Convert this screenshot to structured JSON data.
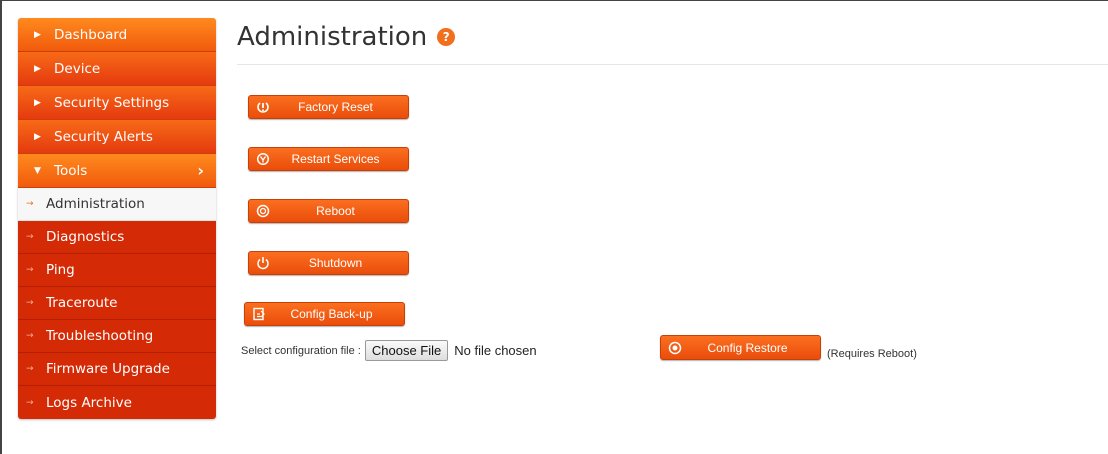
{
  "sidebar": {
    "items": [
      {
        "label": "Dashboard"
      },
      {
        "label": "Device"
      },
      {
        "label": "Security Settings"
      },
      {
        "label": "Security Alerts"
      },
      {
        "label": "Tools"
      }
    ],
    "tools_sub": [
      {
        "label": "Administration",
        "active": true
      },
      {
        "label": "Diagnostics"
      },
      {
        "label": "Ping"
      },
      {
        "label": "Traceroute"
      },
      {
        "label": "Troubleshooting"
      },
      {
        "label": "Firmware Upgrade"
      },
      {
        "label": "Logs Archive"
      }
    ]
  },
  "page": {
    "title": "Administration",
    "help_icon": "?"
  },
  "actions": {
    "factory_reset": "Factory Reset",
    "restart_services": "Restart Services",
    "reboot": "Reboot",
    "shutdown": "Shutdown",
    "config_backup": "Config Back-up",
    "config_restore": "Config Restore"
  },
  "file": {
    "label": "Select configuration file :",
    "button": "Choose File",
    "status": "No file chosen"
  },
  "restore_note": "(Requires Reboot)",
  "colors": {
    "accent": "#f15a0c",
    "submenu": "#d42a06"
  }
}
